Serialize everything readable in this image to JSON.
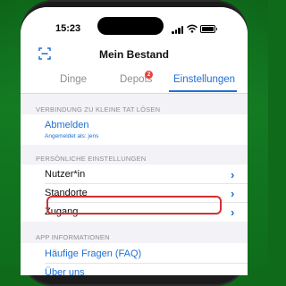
{
  "status": {
    "time": "15:23"
  },
  "nav": {
    "title": "Mein Bestand",
    "scan_icon": "scan-icon"
  },
  "tabs": [
    {
      "label": "Dinge",
      "active": false
    },
    {
      "label": "Depots",
      "active": false,
      "badge": "2"
    },
    {
      "label": "Einstellungen",
      "active": true
    }
  ],
  "sections": {
    "connection": {
      "header": "VERBINDUNG ZU KLEINE TAT LÖSEN",
      "logout_label": "Abmelden",
      "logged_in_as": "Angemeldet als: jens"
    },
    "personal": {
      "header": "PERSÖNLICHE EINSTELLUNGEN",
      "items": [
        "Nutzer*in",
        "Standorte",
        "Zugang"
      ]
    },
    "app_info": {
      "header": "APP INFORMATIONEN",
      "items": [
        "Häufige Fragen (FAQ)",
        "Über uns"
      ]
    }
  },
  "colors": {
    "accent": "#1f6fd1",
    "highlight": "#d23030",
    "badge": "#e8403a",
    "background": "#0f6a1a"
  }
}
